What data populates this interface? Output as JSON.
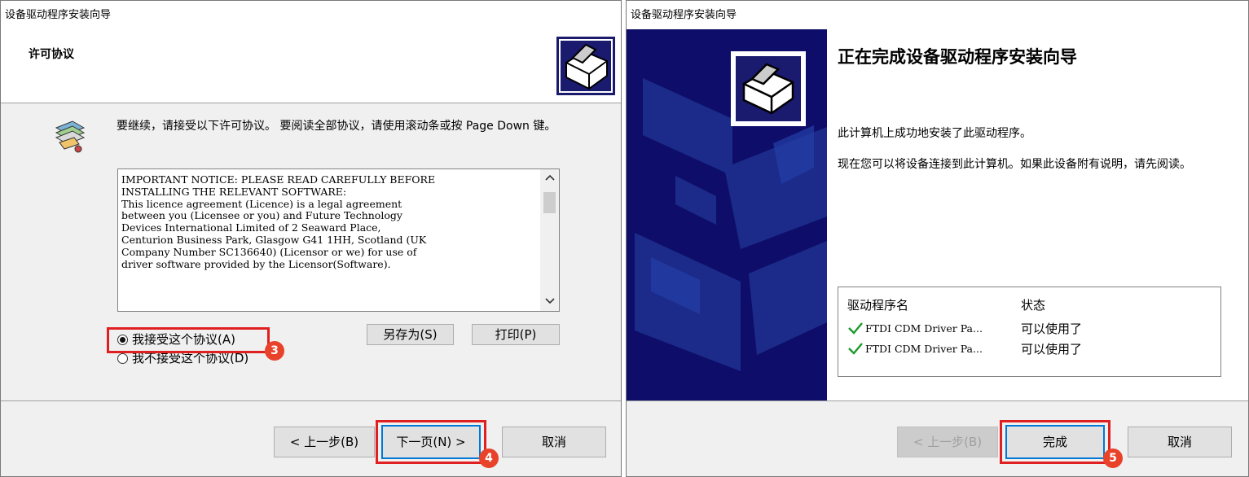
{
  "left": {
    "title": "设备驱动程序安装向导",
    "header_title": "许可协议",
    "instruction": "要继续，请接受以下许可协议。 要阅读全部协议，请使用滚动条或按 Page Down 键。",
    "license_text": "IMPORTANT NOTICE: PLEASE READ CAREFULLY BEFORE\nINSTALLING THE RELEVANT SOFTWARE:\nThis licence agreement (Licence) is a legal agreement\nbetween you (Licensee or you) and Future Technology\nDevices International Limited of 2 Seaward Place,\nCenturion Business Park, Glasgow G41 1HH, Scotland (UK\nCompany Number SC136640) (Licensor or we) for use of\ndriver software provided by the Licensor(Software).",
    "radio_accept": "我接受这个协议(A)",
    "radio_decline": "我不接受这个协议(D)",
    "save_as": "另存为(S)",
    "print": "打印(P)",
    "back": "< 上一步(B)",
    "next": "下一页(N) >",
    "cancel": "取消",
    "badge_3": "3",
    "badge_4": "4"
  },
  "right": {
    "title": "设备驱动程序安装向导",
    "heading": "正在完成设备驱动程序安装向导",
    "success_text": "此计算机上成功地安装了此驱动程序。",
    "connect_text": "现在您可以将设备连接到此计算机。如果此设备附有说明，请先阅读。",
    "table_headers": {
      "name": "驱动程序名",
      "status": "状态"
    },
    "rows": [
      {
        "name": "FTDI CDM Driver Pa...",
        "status": "可以使用了"
      },
      {
        "name": "FTDI CDM Driver Pa...",
        "status": "可以使用了"
      }
    ],
    "back": "< 上一步(B)",
    "finish": "完成",
    "cancel": "取消",
    "badge_5": "5"
  },
  "colors": {
    "accent": "#0078d7",
    "highlight": "#e02020",
    "badge": "#e8432a",
    "wizard_panel": "#0e0e6a",
    "check": "#1a9a2a"
  }
}
